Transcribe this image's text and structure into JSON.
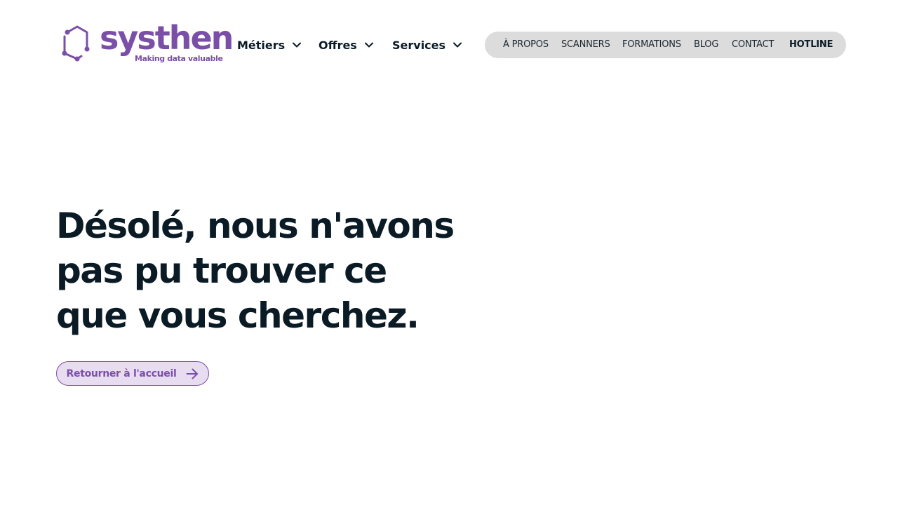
{
  "brand": {
    "name": "systhen",
    "tagline": "Making data valuable",
    "color": "#7b4fa8",
    "logo_icon": "hexagon-network-icon"
  },
  "nav": {
    "main": [
      {
        "label": "Métiers",
        "icon": "chevron-down-icon"
      },
      {
        "label": "Offres",
        "icon": "chevron-down-icon"
      },
      {
        "label": "Services",
        "icon": "chevron-down-icon"
      }
    ],
    "secondary": [
      {
        "label": "À PROPOS"
      },
      {
        "label": "SCANNERS"
      },
      {
        "label": "FORMATIONS"
      },
      {
        "label": "BLOG"
      },
      {
        "label": "CONTACT"
      },
      {
        "label": "HOTLINE"
      }
    ]
  },
  "hero": {
    "title_lines": [
      "Désolé, nous n'avons",
      "pas pu trouver ce",
      "que vous cherchez."
    ],
    "button_label": "Retourner à l'accueil",
    "button_icon": "arrow-right-icon"
  },
  "colors": {
    "text": "#0b1b26",
    "pill_bg": "#dcdcdc",
    "button_bg": "#e8dcf1",
    "accent": "#7b4fa8"
  }
}
